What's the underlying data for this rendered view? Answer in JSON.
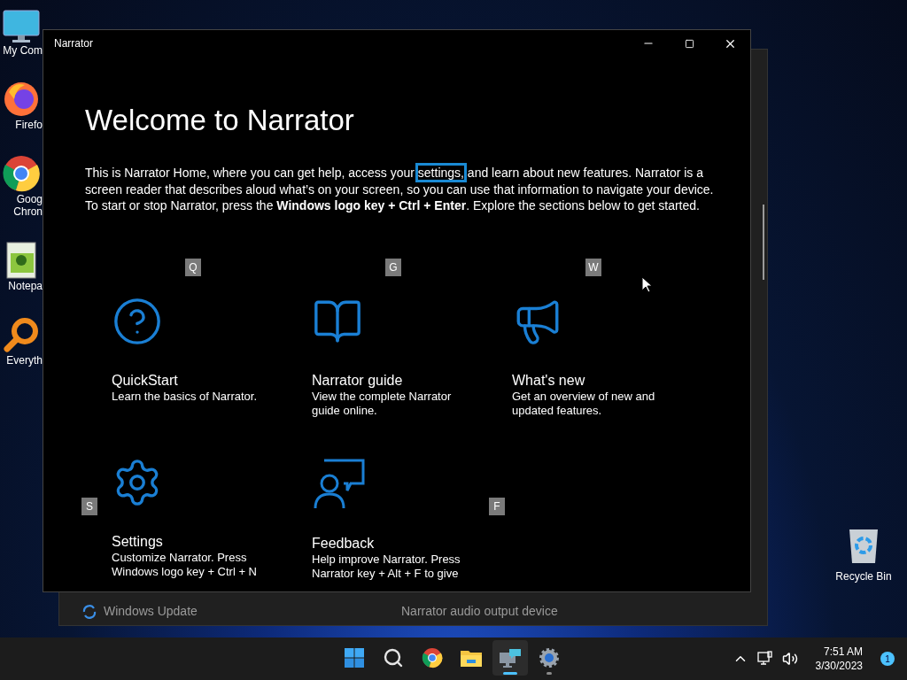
{
  "desktop_icons": [
    {
      "kind": "computer",
      "label_lines": [
        "My Com"
      ]
    },
    {
      "kind": "firefox",
      "label_lines": [
        "Firefo"
      ]
    },
    {
      "kind": "chrome",
      "label_lines": [
        "Goog",
        "Chron"
      ]
    },
    {
      "kind": "notepad",
      "label_lines": [
        "Notepa"
      ]
    },
    {
      "kind": "search",
      "label_lines": [
        "Everyth"
      ]
    }
  ],
  "recycle_bin": {
    "label": "Recycle Bin"
  },
  "background_window": {
    "update_label": "Windows Update",
    "audio_label": "Narrator audio output device"
  },
  "narrator": {
    "title": "Narrator",
    "heading": "Welcome to Narrator",
    "intro": {
      "before": "This is Narrator Home, where you can get help, access your",
      "link": "settings,",
      "link_focused": true,
      "after": "and learn about new features. Narrator is a screen reader that describes aloud what’s on your screen, so you can use that information to navigate your device. To start or stop Narrator, press the **Windows logo key + Ctrl + Enter**. Explore the sections below to get started."
    },
    "cards": [
      {
        "kind": "help",
        "title": "QuickStart",
        "description": "Learn the basics of Narrator.",
        "key": "Q"
      },
      {
        "kind": "book",
        "title": "Narrator guide",
        "description": "View the complete Narrator guide online.",
        "key": "G"
      },
      {
        "kind": "megaphone",
        "title": "What's new",
        "description": "Get an overview of new and updated features.",
        "key": "W"
      },
      {
        "kind": "gear",
        "title": "Settings",
        "description": "Customize Narrator. Press Windows logo key + Ctrl + N",
        "key": "S"
      },
      {
        "kind": "feedback",
        "title": "Feedback",
        "description": "Help improve Narrator. Press Narrator key + Alt + F to give",
        "key": "F"
      }
    ]
  },
  "taskbar": {
    "apps": [
      {
        "kind": "start",
        "active": false,
        "running": false
      },
      {
        "kind": "search",
        "active": false,
        "running": false
      },
      {
        "kind": "chrome",
        "active": false,
        "running": false
      },
      {
        "kind": "explorer",
        "active": false,
        "running": false
      },
      {
        "kind": "narrator",
        "active": true,
        "running": true
      },
      {
        "kind": "settings",
        "active": false,
        "running": true
      }
    ],
    "time": "7:51 AM",
    "date": "3/30/2023",
    "notifications": "1"
  }
}
